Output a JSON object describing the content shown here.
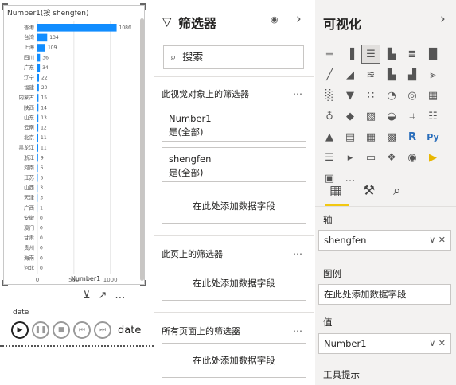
{
  "visual": {
    "title": "Number1(按 shengfen)",
    "x_axis_title": "Number1",
    "y_axis_title": "shengfen",
    "bar_color": "#118dff"
  },
  "chart_data": {
    "type": "bar",
    "orientation": "horizontal",
    "title": "Number1(按 shengfen)",
    "xlabel": "Number1",
    "ylabel": "shengfen",
    "xlim": [
      0,
      1200
    ],
    "x_ticks": [
      "0",
      "500",
      "1000"
    ],
    "categories": [
      "香港",
      "台湾",
      "上海",
      "四川",
      "广东",
      "辽宁",
      "福建",
      "内蒙古",
      "陕西",
      "山东",
      "云南",
      "北京",
      "黑龙江",
      "浙江",
      "河南",
      "江苏",
      "山西",
      "天津",
      "广西",
      "安徽",
      "澳门",
      "甘肃",
      "贵州",
      "海南",
      "河北"
    ],
    "values": [
      1086,
      134,
      109,
      36,
      34,
      22,
      20,
      15,
      14,
      13,
      12,
      11,
      11,
      9,
      6,
      5,
      3,
      3,
      1,
      0,
      0,
      0,
      0,
      0,
      0
    ],
    "data_labels": [
      "1086",
      "134",
      "109",
      "36",
      "34",
      "22",
      "20",
      "15",
      "14",
      "13",
      "12",
      "11",
      "11",
      "9",
      "6",
      "5",
      "3",
      "3",
      "1",
      "0",
      "0",
      "0",
      "0",
      "0",
      "0"
    ],
    "grid": true,
    "legend": "none"
  },
  "slicer": {
    "label": "date",
    "player_label": "date"
  },
  "filters": {
    "title": "筛选器",
    "search_placeholder": "搜索",
    "section_visual": "此视觉对象上的筛选器",
    "section_page": "此页上的筛选器",
    "section_all": "所有页面上的筛选器",
    "more": "…",
    "cards": [
      {
        "field": "Number1",
        "value": "是(全部)"
      },
      {
        "field": "shengfen",
        "value": "是(全部)"
      }
    ],
    "add_field": "在此处添加数据字段"
  },
  "viz": {
    "title": "可视化",
    "more_icon": "…",
    "wells": {
      "axis_label": "轴",
      "axis_value": "shengfen",
      "legend_label": "图例",
      "legend_placeholder": "在此处添加数据字段",
      "values_label": "值",
      "values_value": "Number1",
      "tooltip_label": "工具提示"
    }
  }
}
